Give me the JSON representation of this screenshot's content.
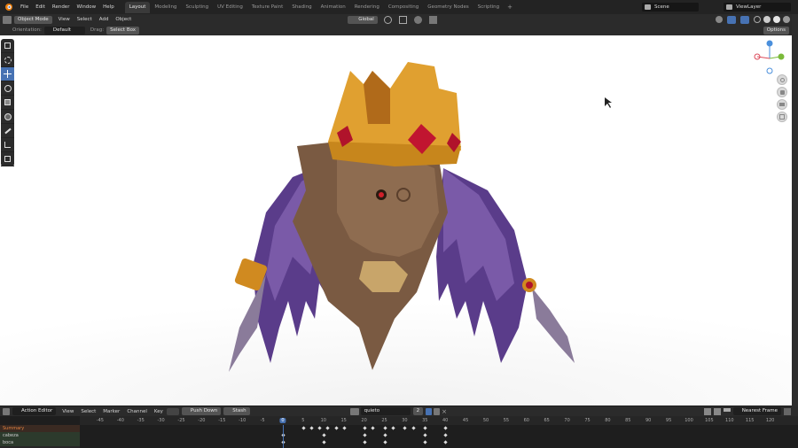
{
  "menu": [
    "File",
    "Edit",
    "Render",
    "Window",
    "Help"
  ],
  "workspaces": [
    {
      "label": "Layout",
      "active": true
    },
    {
      "label": "Modeling",
      "active": false
    },
    {
      "label": "Sculpting",
      "active": false
    },
    {
      "label": "UV Editing",
      "active": false
    },
    {
      "label": "Texture Paint",
      "active": false
    },
    {
      "label": "Shading",
      "active": false
    },
    {
      "label": "Animation",
      "active": false
    },
    {
      "label": "Rendering",
      "active": false
    },
    {
      "label": "Compositing",
      "active": false
    },
    {
      "label": "Geometry Nodes",
      "active": false
    },
    {
      "label": "Scripting",
      "active": false
    }
  ],
  "scene": {
    "label": "Scene"
  },
  "view_layer": {
    "label": "ViewLayer"
  },
  "viewport_header": {
    "mode": "Object Mode",
    "menus": [
      "View",
      "Select",
      "Add",
      "Object"
    ],
    "transform_orientation": "Global"
  },
  "tool_settings": {
    "orientation_label": "Orientation:",
    "orientation_value": "Default",
    "drag_label": "Drag:",
    "drag_value": "Select Box",
    "options": "Options"
  },
  "action_editor": {
    "editor": "Action Editor",
    "menus": [
      "View",
      "Select",
      "Marker",
      "Channel",
      "Key"
    ],
    "push_down": "Push Down",
    "stash": "Stash",
    "action_name": "quieto",
    "users": "2",
    "snapping": "Nearest Frame"
  },
  "timeline": {
    "current_frame": 0,
    "ticks": [
      -45,
      -40,
      -35,
      -30,
      -25,
      -20,
      -15,
      -10,
      -5,
      0,
      5,
      10,
      15,
      20,
      25,
      30,
      35,
      40,
      45,
      50,
      55,
      60,
      65,
      70,
      75,
      80,
      85,
      90,
      95,
      100,
      105,
      110,
      115,
      120
    ],
    "channels": [
      {
        "label": "Summary"
      },
      {
        "label": "cabeza"
      },
      {
        "label": "boca"
      }
    ]
  },
  "colors": {
    "accent": "#4772b3",
    "panel": "#2b2b2b"
  }
}
